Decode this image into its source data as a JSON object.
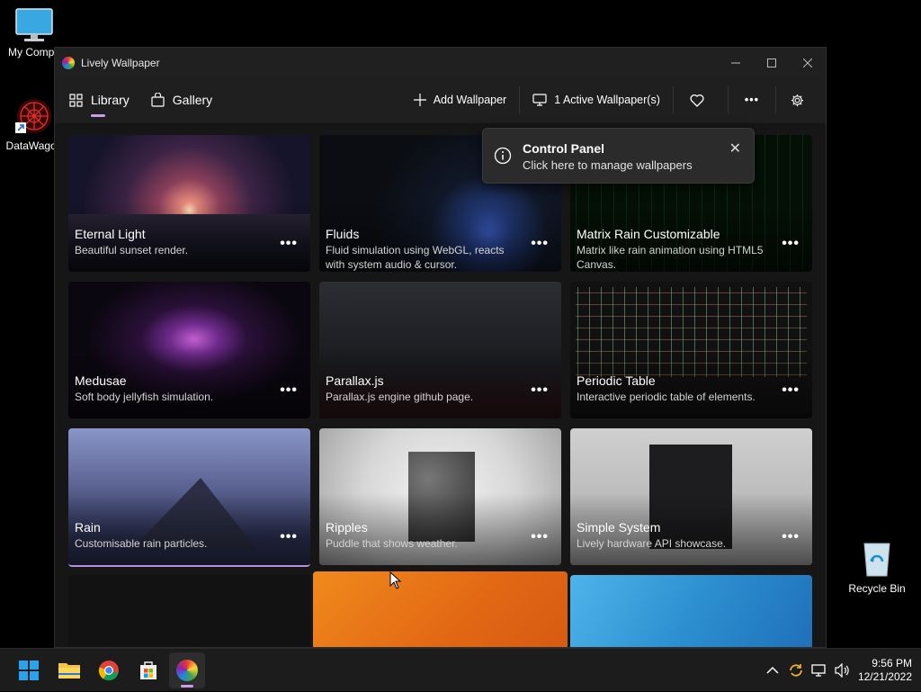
{
  "desktop": {
    "icons": [
      {
        "label": "My Compu",
        "name": "my-computer"
      },
      {
        "label": "DataWagon",
        "name": "datawagon"
      },
      {
        "label": "Recycle Bin",
        "name": "recycle-bin"
      }
    ]
  },
  "window": {
    "title": "Lively Wallpaper",
    "controls": [
      "minimize",
      "maximize",
      "close"
    ]
  },
  "nav": {
    "library_label": "Library",
    "gallery_label": "Gallery",
    "add_wallpaper_label": "Add Wallpaper",
    "active_wallpapers_label": "1 Active Wallpaper(s)",
    "more_label": "•••",
    "icons": {
      "library": "grid-icon",
      "gallery": "bag-icon",
      "add": "plus-icon",
      "monitor": "monitor-icon",
      "favorite": "heart-icon",
      "settings": "gear-icon"
    }
  },
  "toast": {
    "title": "Control Panel",
    "message": "Click here to manage wallpapers",
    "close_glyph": "✕"
  },
  "wallpapers": [
    {
      "name": "Eternal Light",
      "description": "Beautiful sunset render.",
      "more": "•••"
    },
    {
      "name": "Fluids",
      "description": "Fluid simulation using WebGL, reacts with system audio & cursor.",
      "more": "•••"
    },
    {
      "name": "Matrix Rain Customizable",
      "description": "Matrix like rain animation using HTML5 Canvas.",
      "more": "•••"
    },
    {
      "name": "Medusae",
      "description": "Soft body jellyfish simulation.",
      "more": "•••"
    },
    {
      "name": "Parallax.js",
      "description": "Parallax.js engine github page.",
      "more": "•••"
    },
    {
      "name": "Periodic Table",
      "description": "Interactive periodic table of elements.",
      "more": "•••"
    },
    {
      "name": "Rain",
      "description": "Customisable rain particles.",
      "more": "•••",
      "selected": true
    },
    {
      "name": "Ripples",
      "description": "Puddle that shows weather.",
      "more": "•••"
    },
    {
      "name": "Simple System",
      "description": "Lively hardware API showcase.",
      "more": "•••"
    }
  ],
  "taskbar": {
    "apps": [
      "start",
      "file-explorer",
      "chrome",
      "microsoft-store",
      "lively-wallpaper"
    ],
    "time": "9:56 PM",
    "date": "12/21/2022"
  },
  "colors": {
    "accent": "#c9a0e8",
    "window_bg": "#1b1b1b",
    "toast_bg": "#2b2b2b"
  }
}
